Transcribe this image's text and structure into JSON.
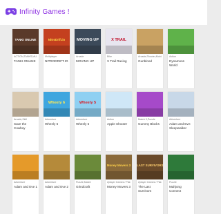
{
  "header": {
    "brand": "Infinity Games !",
    "logo_icon": "gamepad-icon",
    "accent": "#8a2be2"
  },
  "games": [
    {
      "category": "ACTION,TANKS,MU...",
      "title": "TANKI ONLINE",
      "thumb_text": "TANKI ONLINE",
      "thumb_bg": "#5a3a2a",
      "thumb_fg": "#ffffff"
    },
    {
      "category": "Multiplayer",
      "title": "NITRODRIFT.IO",
      "thumb_text": "NitroDrift.io",
      "thumb_bg": "#c4401f",
      "thumb_fg": "#ffe24a"
    },
    {
      "category": "Arcade",
      "title": "MOVING UP",
      "thumb_text": "MOVING UP",
      "thumb_bg": "#3c4a5a",
      "thumb_fg": "#ffffff"
    },
    {
      "category": "Bike",
      "title": "X Trail Racing",
      "thumb_text": "X TRAIL",
      "thumb_bg": "#e8e6f0",
      "thumb_fg": "#c0102a"
    },
    {
      "category": "Arcade,Shooter,Mobi...",
      "title": "Gunblood",
      "thumb_text": "",
      "thumb_bg": "#c9a263",
      "thumb_fg": "#ffffff"
    },
    {
      "category": "Action",
      "title": "Dynamons World",
      "thumb_text": "",
      "thumb_bg": "#5fb24a",
      "thumb_fg": "#ffffff"
    },
    {
      "category": "Arcade,Skill",
      "title": "Save the Cowboy",
      "thumb_text": "",
      "thumb_bg": "#d9c9b0",
      "thumb_fg": "#ffffff"
    },
    {
      "category": "Adventure",
      "title": "Wheely 6",
      "thumb_text": "Wheely 6",
      "thumb_bg": "#3fa6df",
      "thumb_fg": "#ffea55"
    },
    {
      "category": "Adventure",
      "title": "Wheely 5",
      "thumb_text": "Wheely 5",
      "thumb_bg": "#8fd0f2",
      "thumb_fg": "#d81f2a"
    },
    {
      "category": "Action",
      "title": "Apple Shooter",
      "thumb_text": "",
      "thumb_bg": "#cfe7f7",
      "thumb_fg": "#ffffff"
    },
    {
      "category": "Match 3,Puzzle",
      "title": "Gummy Blocks",
      "thumb_text": "",
      "thumb_bg": "#a64ac9",
      "thumb_fg": "#ffffff"
    },
    {
      "category": "Adventure",
      "title": "Adam and Eve: Sleepwalker",
      "thumb_text": "",
      "thumb_bg": "#c8d8e8",
      "thumb_fg": "#ffffff"
    },
    {
      "category": "Adventure",
      "title": "Adam and Eve 1",
      "thumb_text": "",
      "thumb_bg": "#e59a2a",
      "thumb_fg": "#ffffff"
    },
    {
      "category": "Adventure",
      "title": "Adam and Eve 2",
      "thumb_text": "",
      "thumb_bg": "#b58a3a",
      "thumb_fg": "#ffffff"
    },
    {
      "category": "Puzzle,Match",
      "title": "Grindcraft",
      "thumb_text": "",
      "thumb_bg": "#6b8a3a",
      "thumb_fg": "#ffffff"
    },
    {
      "category": "2player Games / Plat...",
      "title": "Money Movers 3",
      "thumb_text": "Money Movers 3",
      "thumb_bg": "#8a6a3a",
      "thumb_fg": "#ffd24a"
    },
    {
      "category": "2player Games / Plat...",
      "title": "The Last Survivors",
      "thumb_text": "LAST SURVIVORS",
      "thumb_bg": "#6a4a2a",
      "thumb_fg": "#ffd070"
    },
    {
      "category": "Puzzle",
      "title": "Mahjong Connect",
      "thumb_text": "",
      "thumb_bg": "#2e7a3a",
      "thumb_fg": "#ffffff"
    }
  ]
}
